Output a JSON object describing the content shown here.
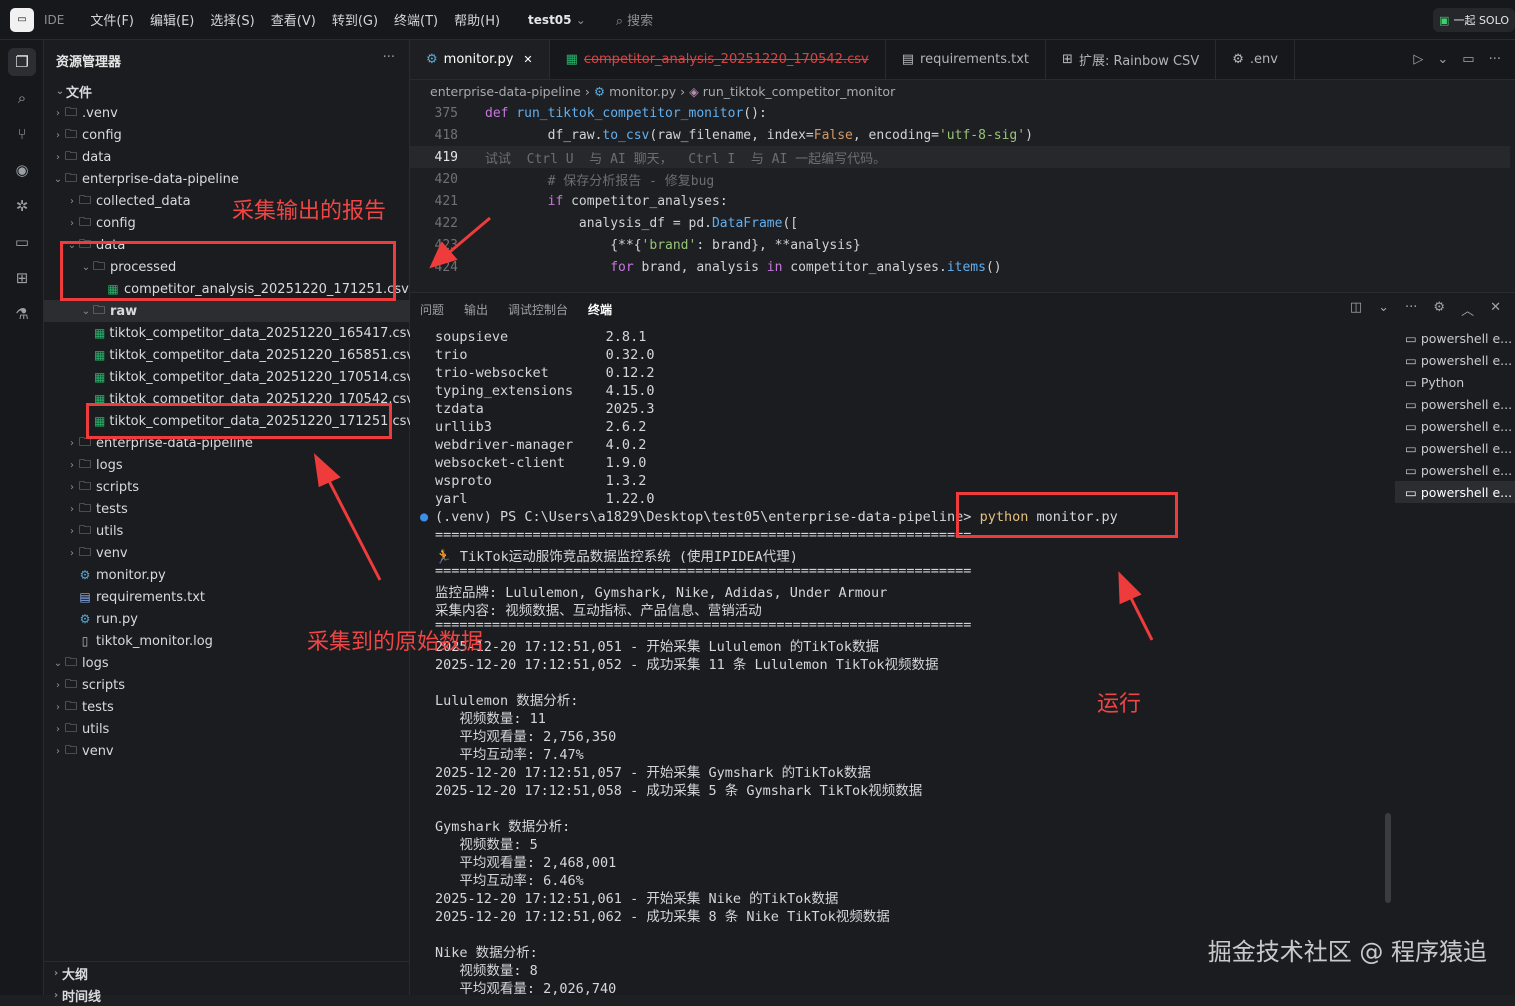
{
  "topbar": {
    "ide_label": "IDE",
    "menu": [
      "文件(F)",
      "编辑(E)",
      "选择(S)",
      "查看(V)",
      "转到(G)",
      "终端(T)",
      "帮助(H)"
    ],
    "project": "test05",
    "search_label": "搜索",
    "solo_label": "一起 SOLO"
  },
  "sidebar": {
    "title": "资源管理器",
    "section": "文件",
    "tree": [
      {
        "label": ".venv",
        "type": "folder",
        "depth": 0,
        "open": false
      },
      {
        "label": "config",
        "type": "folder",
        "depth": 0,
        "open": false
      },
      {
        "label": "data",
        "type": "folder",
        "depth": 0,
        "open": false
      },
      {
        "label": "enterprise-data-pipeline",
        "type": "folder",
        "depth": 0,
        "open": true
      },
      {
        "label": "collected_data",
        "type": "folder",
        "depth": 1,
        "open": false
      },
      {
        "label": "config",
        "type": "folder",
        "depth": 1,
        "open": false
      },
      {
        "label": "data",
        "type": "folder",
        "depth": 1,
        "open": true
      },
      {
        "label": "processed",
        "type": "folder",
        "depth": 2,
        "open": true
      },
      {
        "label": "competitor_analysis_20251220_171251.csv",
        "type": "csv",
        "depth": 3
      },
      {
        "label": "raw",
        "type": "folder",
        "depth": 2,
        "open": true,
        "selected": true
      },
      {
        "label": "tiktok_competitor_data_20251220_165417.csv",
        "type": "csv",
        "depth": 3
      },
      {
        "label": "tiktok_competitor_data_20251220_165851.csv",
        "type": "csv",
        "depth": 3
      },
      {
        "label": "tiktok_competitor_data_20251220_170514.csv",
        "type": "csv",
        "depth": 3
      },
      {
        "label": "tiktok_competitor_data_20251220_170542.csv",
        "type": "csv",
        "depth": 3
      },
      {
        "label": "tiktok_competitor_data_20251220_171251.csv",
        "type": "csv",
        "depth": 3
      },
      {
        "label": "enterprise-data-pipeline",
        "type": "folder",
        "depth": 1,
        "open": false
      },
      {
        "label": "logs",
        "type": "folder",
        "depth": 1,
        "open": false
      },
      {
        "label": "scripts",
        "type": "folder",
        "depth": 1,
        "open": false
      },
      {
        "label": "tests",
        "type": "folder",
        "depth": 1,
        "open": false
      },
      {
        "label": "utils",
        "type": "folder",
        "depth": 1,
        "open": false
      },
      {
        "label": "venv",
        "type": "folder",
        "depth": 1,
        "open": false
      },
      {
        "label": "monitor.py",
        "type": "py",
        "depth": 1
      },
      {
        "label": "requirements.txt",
        "type": "txt",
        "depth": 1
      },
      {
        "label": "run.py",
        "type": "py",
        "depth": 1
      },
      {
        "label": "tiktok_monitor.log",
        "type": "file",
        "depth": 1
      },
      {
        "label": "logs",
        "type": "folder",
        "depth": 0,
        "open": true
      },
      {
        "label": "scripts",
        "type": "folder",
        "depth": 0,
        "open": false
      },
      {
        "label": "tests",
        "type": "folder",
        "depth": 0,
        "open": false
      },
      {
        "label": "utils",
        "type": "folder",
        "depth": 0,
        "open": false
      },
      {
        "label": "venv",
        "type": "folder",
        "depth": 0,
        "open": false
      }
    ],
    "outline_label": "大纲",
    "timeline_label": "时间线"
  },
  "annotations": {
    "report": "采集输出的报告",
    "raw": "采集到的原始数据",
    "run": "运行"
  },
  "editor": {
    "tabs": [
      {
        "label": "monitor.py",
        "icon": "py",
        "active": true
      },
      {
        "label": "competitor_analysis_20251220_170542.csv",
        "icon": "csv",
        "deleted": true
      },
      {
        "label": "requirements.txt",
        "icon": "txt"
      },
      {
        "label": "扩展: Rainbow CSV",
        "icon": "ext"
      },
      {
        "label": ".env",
        "icon": "gear"
      }
    ],
    "breadcrumb": [
      "enterprise-data-pipeline",
      "monitor.py",
      "run_tiktok_competitor_monitor"
    ],
    "lines": [
      {
        "n": "375",
        "html": "<span class='kw'>def</span> <span class='fn'>run_tiktok_competitor_monitor</span>():"
      },
      {
        "n": "418",
        "html": "        df_raw.<span class='fn'>to_csv</span>(raw_filename, index=<span class='bool'>False</span>, encoding=<span class='str'>'utf-8-sig'</span>)"
      },
      {
        "n": "419",
        "html": "<span class='cmt'>试试  Ctrl U  与 AI 聊天，  Ctrl I  与 AI 一起编写代码。</span>",
        "current": true
      },
      {
        "n": "420",
        "html": "        <span class='cmt'># 保存分析报告 - 修复bug</span>"
      },
      {
        "n": "421",
        "html": "        <span class='kw'>if</span> competitor_analyses:"
      },
      {
        "n": "422",
        "html": "            analysis_df = pd.<span class='fn'>DataFrame</span>(["
      },
      {
        "n": "423",
        "html": "                {**{<span class='str'>'brand'</span>: brand}, **analysis}"
      },
      {
        "n": "424",
        "html": "                <span class='kw'>for</span> brand, analysis <span class='kw'>in</span> competitor_analyses.<span class='fn'>items</span>()"
      }
    ]
  },
  "panel": {
    "tabs": [
      "问题",
      "输出",
      "调试控制台",
      "终端"
    ],
    "active_tab": "终端",
    "terminal_lines": [
      "soupsieve            2.8.1",
      "trio                 0.32.0",
      "trio-websocket       0.12.2",
      "typing_extensions    4.15.0",
      "tzdata               2025.3",
      "urllib3              2.6.2",
      "webdriver-manager    4.0.2",
      "websocket-client     1.9.0",
      "wsproto              1.3.2",
      "yarl                 1.22.0",
      "(.venv) PS C:\\Users\\a1829\\Desktop\\test05\\enterprise-data-pipeline> python monitor.py",
      "==================================================================",
      "🏃 TikTok运动服饰竞品数据监控系统 (使用IPIDEA代理)",
      "==================================================================",
      "监控品牌: Lululemon, Gymshark, Nike, Adidas, Under Armour",
      "采集内容: 视频数据、互动指标、产品信息、营销活动",
      "==================================================================",
      "2025-12-20 17:12:51,051 - 开始采集 Lululemon 的TikTok数据",
      "2025-12-20 17:12:51,052 - 成功采集 11 条 Lululemon TikTok视频数据",
      "",
      "Lululemon 数据分析:",
      "   视频数量: 11",
      "   平均观看量: 2,756,350",
      "   平均互动率: 7.47%",
      "2025-12-20 17:12:51,057 - 开始采集 Gymshark 的TikTok数据",
      "2025-12-20 17:12:51,058 - 成功采集 5 条 Gymshark TikTok视频数据",
      "",
      "Gymshark 数据分析:",
      "   视频数量: 5",
      "   平均观看量: 2,468,001",
      "   平均互动率: 6.46%",
      "2025-12-20 17:12:51,061 - 开始采集 Nike 的TikTok数据",
      "2025-12-20 17:12:51,062 - 成功采集 8 条 Nike TikTok视频数据",
      "",
      "Nike 数据分析:",
      "   视频数量: 8",
      "   平均观看量: 2,026,740"
    ],
    "terminals": [
      {
        "label": "powershell e..."
      },
      {
        "label": "powershell e..."
      },
      {
        "label": "Python"
      },
      {
        "label": "powershell e..."
      },
      {
        "label": "powershell e..."
      },
      {
        "label": "powershell e..."
      },
      {
        "label": "powershell e..."
      },
      {
        "label": "powershell e...",
        "selected": true
      }
    ]
  },
  "watermark": "掘金技术社区 @ 程序猿追"
}
